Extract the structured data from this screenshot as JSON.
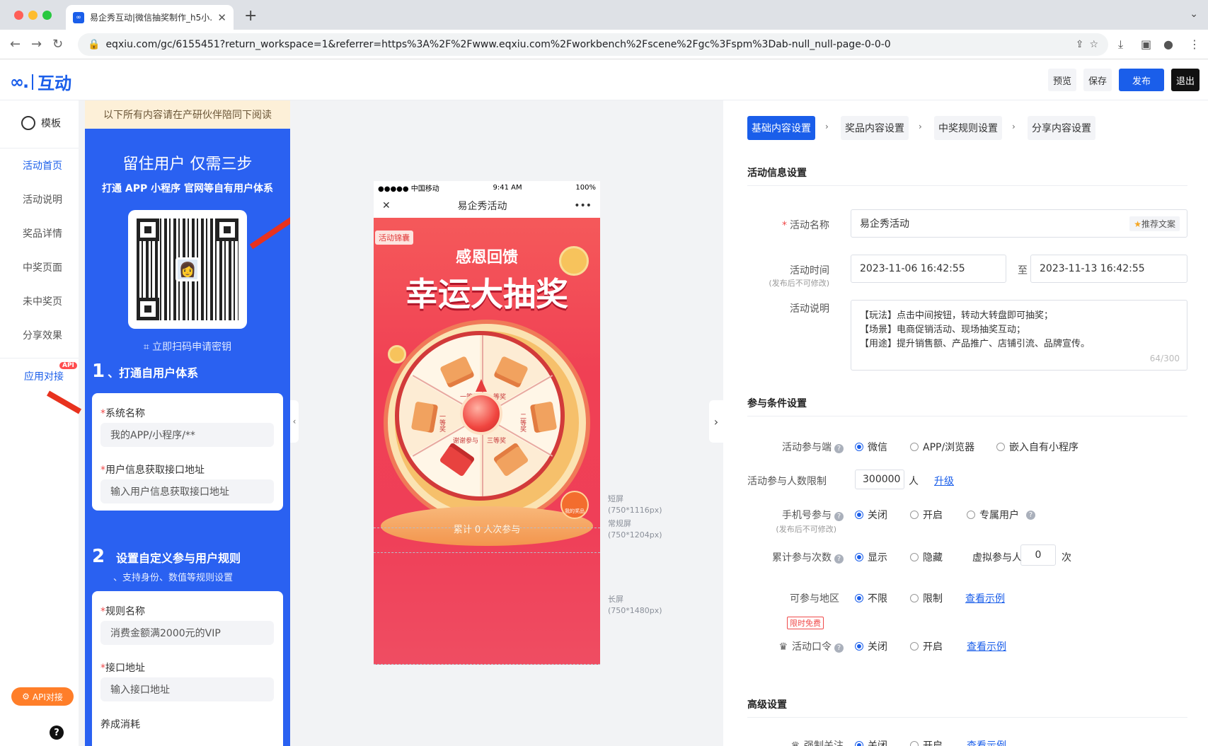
{
  "browser": {
    "tab_title": "易企秀互动|微信抽奖制作_h5小...",
    "url": "eqxiu.com/gc/6155451?return_workspace=1&referrer=https%3A%2F%2Fwww.eqxiu.com%2Fworkbench%2Fscene%2Fgc%3Fspm%3Dab-null_null-page-0-0-0"
  },
  "header": {
    "logo_text": "互动",
    "buttons": {
      "preview": "预览",
      "save": "保存",
      "publish": "发布",
      "exit": "退出"
    }
  },
  "leftnav": {
    "template": "模板",
    "items": [
      "活动首页",
      "活动说明",
      "奖品详情",
      "中奖页面",
      "未中奖页",
      "分享效果"
    ],
    "app_link": "应用对接",
    "api_badge": "API",
    "api_button": "API对接",
    "help": "?"
  },
  "promo": {
    "note": "以下所有内容请在产研伙伴陪同下阅读",
    "title": "留住用户 仅需三步",
    "subtitle": "打通 APP 小程序 官网等自有用户体系",
    "scan_link": "立即扫码申请密钥",
    "step1": {
      "num": "1",
      "title": "、打通自用户体系"
    },
    "step1_fields": [
      {
        "label": "系统名称",
        "placeholder": "我的APP/小程序/**"
      },
      {
        "label": "用户信息获取接口地址",
        "placeholder": "输入用户信息获取接口地址"
      }
    ],
    "step2": {
      "num": "2",
      "title": "设置自定义参与用户规则",
      "subtitle": "、支持身份、数值等规则设置"
    },
    "step2_fields": [
      {
        "label": "规则名称",
        "placeholder": "消费金额满2000元的VIP"
      },
      {
        "label": "接口地址",
        "placeholder": "输入接口地址"
      }
    ],
    "step2_more": "养成消耗"
  },
  "phone": {
    "carrier": "●●●●● 中国移动",
    "time": "9:41 AM",
    "battery": "100%",
    "nav_title": "易企秀活动",
    "tag": "活动锦囊",
    "title_small": "感恩回馈",
    "title_big": "幸运大抽奖",
    "participants": "累计 0 人次参与",
    "gift_label": "我的奖品",
    "prize_labels": [
      "一等奖",
      "一等奖",
      "二等奖",
      "三等奖",
      "谢谢参与",
      "一等奖"
    ],
    "screen_labels": [
      {
        "name": "短屏",
        "size": "(750*1116px)"
      },
      {
        "name": "常规屏",
        "size": "(750*1204px)"
      },
      {
        "name": "长屏",
        "size": "(750*1480px)"
      }
    ]
  },
  "settings": {
    "steps": [
      "基础内容设置",
      "奖品内容设置",
      "中奖规则设置",
      "分享内容设置"
    ],
    "activity_info": {
      "section": "活动信息设置",
      "name_label": "活动名称",
      "name_value": "易企秀活动",
      "recommend": "推荐文案",
      "time_label": "活动时间",
      "time_note": "(发布后不可修改)",
      "start": "2023-11-06 16:42:55",
      "to": "至",
      "end": "2023-11-13 16:42:55",
      "desc_label": "活动说明",
      "desc_lines": [
        "【玩法】点击中间按钮，转动大转盘即可抽奖；",
        "【场景】电商促销活动、现场抽奖互动；",
        "【用途】提升销售额、产品推广、店铺引流、品牌宣传。"
      ],
      "desc_count": "64/300"
    },
    "participation": {
      "section": "参与条件设置",
      "terminal_label": "活动参与端",
      "terminal_options": [
        "微信",
        "APP/浏览器",
        "嵌入自有小程序"
      ],
      "limit_label": "活动参与人数限制",
      "limit_value": "300000",
      "limit_unit": "人",
      "upgrade": "升级",
      "phone_label": "手机号参与",
      "phone_note": "(发布后不可修改)",
      "phone_options": [
        "关闭",
        "开启",
        "专属用户"
      ],
      "count_label": "累计参与次数",
      "count_options": [
        "显示",
        "隐藏"
      ],
      "virtual_label": "虚拟参与人",
      "virtual_value": "0",
      "virtual_unit": "次",
      "region_label": "可参与地区",
      "region_tag": "限时免费",
      "region_options": [
        "不限",
        "限制"
      ],
      "view_example": "查看示例",
      "password_label": "活动口令",
      "password_options": [
        "关闭",
        "开启"
      ]
    },
    "advanced": {
      "section": "高级设置",
      "follow_label": "强制关注",
      "follow_options": [
        "关闭",
        "开启"
      ]
    }
  },
  "colors": {
    "brand": "#1a5eea",
    "promo_blue": "#2a61f1",
    "accent_red": "#e8321e"
  }
}
